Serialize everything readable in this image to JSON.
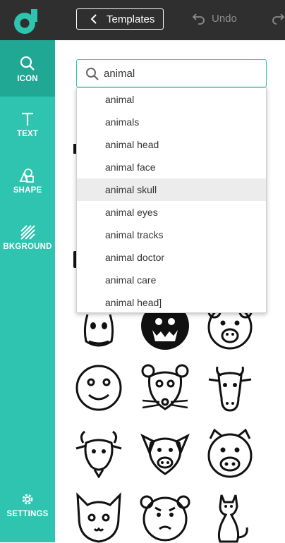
{
  "topbar": {
    "templates_label": "Templates",
    "undo_label": "Undo"
  },
  "sidebar": {
    "items": [
      {
        "label": "ICON",
        "icon": "search-icon"
      },
      {
        "label": "TEXT",
        "icon": "text-icon"
      },
      {
        "label": "SHAPE",
        "icon": "shape-icon"
      },
      {
        "label": "BKGROUND",
        "icon": "background-icon"
      },
      {
        "label": "SETTINGS",
        "icon": "gear-icon"
      }
    ]
  },
  "search": {
    "value": "animal"
  },
  "suggestions": [
    "animal",
    "animals",
    "animal head",
    "animal face",
    "animal skull",
    "animal eyes",
    "animal tracks",
    "animal doctor",
    "animal care",
    "animal head]"
  ],
  "icons": [
    "hippo-icon",
    "gorilla-icon",
    "bear-icon",
    "smiley-face-icon",
    "mouse-icon",
    "cow-icon",
    "goat-icon",
    "pig-icon",
    "pig-face-icon",
    "cat-face-icon",
    "monkey-face-icon",
    "cat-sitting-icon"
  ],
  "colors": {
    "accent": "#2ec4b0",
    "accent_dark": "#20a894",
    "topbar": "#2f2f30"
  }
}
